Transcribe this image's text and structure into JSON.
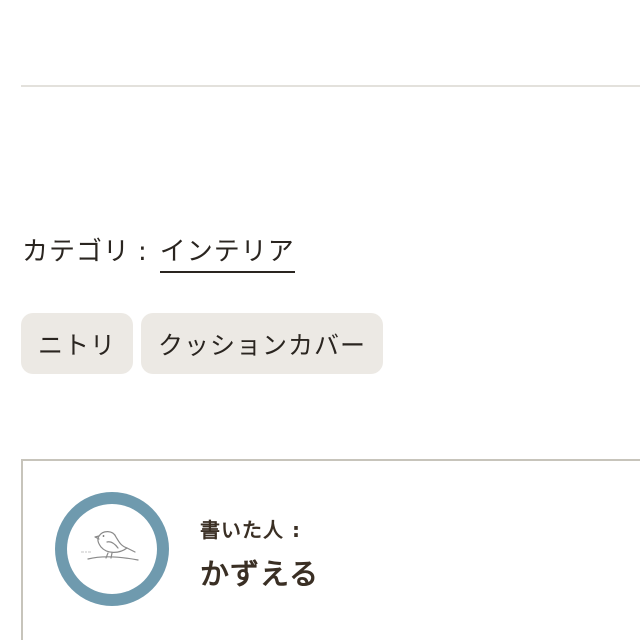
{
  "category": {
    "label": "カテゴリ",
    "separator": ":",
    "value": "インテリア"
  },
  "tags": [
    {
      "label": "ニトリ"
    },
    {
      "label": "クッションカバー"
    }
  ],
  "author": {
    "label": "書いた人 :",
    "name": "かずえる",
    "avatar_icon": "bird-illustration-icon",
    "avatar_color": "#6f9aae"
  }
}
